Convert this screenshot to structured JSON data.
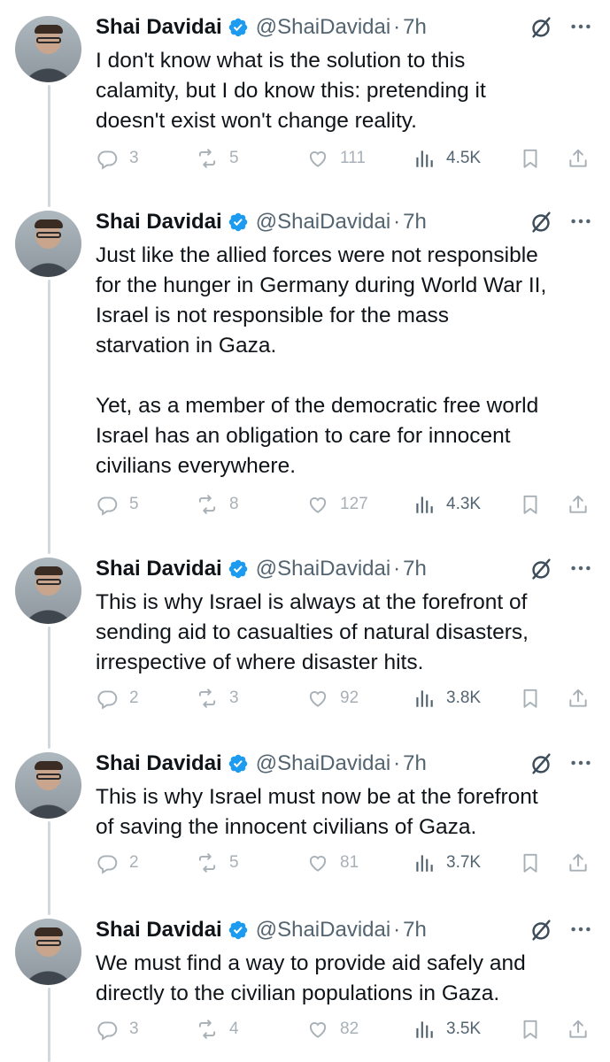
{
  "tweets": [
    {
      "name": "Shai Davidai",
      "handle": "@ShaiDavidai",
      "dot": "·",
      "time": "7h",
      "text": "I don't know what is the solution to this\ncalamity, but I do know this: pretending it\ndoesn't exist won't change reality.",
      "replies": "3",
      "retweets": "5",
      "likes": "111",
      "views": "4.5K"
    },
    {
      "name": "Shai Davidai",
      "handle": "@ShaiDavidai",
      "dot": "·",
      "time": "7h",
      "text": "Just like the allied forces were not responsible\nfor the hunger in Germany during World War II,\nIsrael is not responsible for the mass\nstarvation in Gaza.\n\nYet, as a member of the democratic free world\nIsrael has an obligation to care for innocent\ncivilians everywhere.",
      "replies": "5",
      "retweets": "8",
      "likes": "127",
      "views": "4.3K"
    },
    {
      "name": "Shai Davidai",
      "handle": "@ShaiDavidai",
      "dot": "·",
      "time": "7h",
      "text": "This is why Israel is always at the forefront of\nsending aid to casualties of natural disasters,\nirrespective of where disaster hits.",
      "replies": "2",
      "retweets": "3",
      "likes": "92",
      "views": "3.8K"
    },
    {
      "name": "Shai Davidai",
      "handle": "@ShaiDavidai",
      "dot": "·",
      "time": "7h",
      "text": "This is why Israel must now be at the forefront\nof saving the innocent civilians of Gaza.",
      "replies": "2",
      "retweets": "5",
      "likes": "81",
      "views": "3.7K"
    },
    {
      "name": "Shai Davidai",
      "handle": "@ShaiDavidai",
      "dot": "·",
      "time": "7h",
      "text": "We must find a way to provide aid safely and\ndirectly to the civilian populations in Gaza.",
      "replies": "3",
      "retweets": "4",
      "likes": "82",
      "views": "3.5K"
    }
  ],
  "colors": {
    "verified": "#1d9bf0",
    "secondary_text": "#536471",
    "thread_line": "#cfd9de"
  },
  "icons": [
    "verified-badge-icon",
    "grok-icon",
    "more-icon",
    "reply-icon",
    "retweet-icon",
    "like-icon",
    "views-icon",
    "bookmark-icon",
    "share-icon"
  ]
}
